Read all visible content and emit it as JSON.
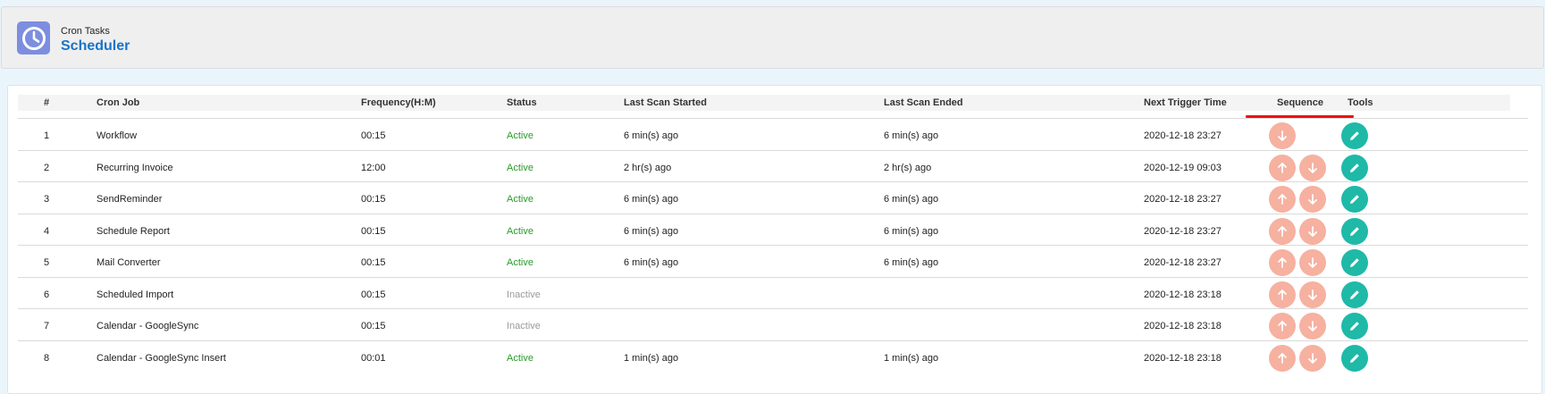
{
  "header": {
    "module": "Cron Tasks",
    "title": "Scheduler"
  },
  "table": {
    "columns": {
      "num": "#",
      "cron_job": "Cron Job",
      "frequency": "Frequency(H:M)",
      "status": "Status",
      "last_scan_started": "Last Scan Started",
      "last_scan_ended": "Last Scan Ended",
      "next_trigger_time": "Next Trigger Time",
      "sequence": "Sequence",
      "tools": "Tools"
    },
    "sorted_column": "Next Trigger Time",
    "rows": [
      {
        "num": "1",
        "cron_job": "Workflow",
        "frequency": "00:15",
        "status": "Active",
        "last_scan_started": "6 min(s) ago",
        "last_scan_ended": "6 min(s) ago",
        "next_trigger_time": "2020-12-18 23:27",
        "sequence": [
          "down"
        ]
      },
      {
        "num": "2",
        "cron_job": "Recurring Invoice",
        "frequency": "12:00",
        "status": "Active",
        "last_scan_started": "2 hr(s) ago",
        "last_scan_ended": "2 hr(s) ago",
        "next_trigger_time": "2020-12-19 09:03",
        "sequence": [
          "up",
          "down"
        ]
      },
      {
        "num": "3",
        "cron_job": "SendReminder",
        "frequency": "00:15",
        "status": "Active",
        "last_scan_started": "6 min(s) ago",
        "last_scan_ended": "6 min(s) ago",
        "next_trigger_time": "2020-12-18 23:27",
        "sequence": [
          "up",
          "down"
        ]
      },
      {
        "num": "4",
        "cron_job": "Schedule Report",
        "frequency": "00:15",
        "status": "Active",
        "last_scan_started": "6 min(s) ago",
        "last_scan_ended": "6 min(s) ago",
        "next_trigger_time": "2020-12-18 23:27",
        "sequence": [
          "up",
          "down"
        ]
      },
      {
        "num": "5",
        "cron_job": "Mail Converter",
        "frequency": "00:15",
        "status": "Active",
        "last_scan_started": "6 min(s) ago",
        "last_scan_ended": "6 min(s) ago",
        "next_trigger_time": "2020-12-18 23:27",
        "sequence": [
          "up",
          "down"
        ]
      },
      {
        "num": "6",
        "cron_job": "Scheduled Import",
        "frequency": "00:15",
        "status": "Inactive",
        "last_scan_started": "",
        "last_scan_ended": "",
        "next_trigger_time": "2020-12-18 23:18",
        "sequence": [
          "up",
          "down"
        ]
      },
      {
        "num": "7",
        "cron_job": "Calendar - GoogleSync",
        "frequency": "00:15",
        "status": "Inactive",
        "last_scan_started": "",
        "last_scan_ended": "",
        "next_trigger_time": "2020-12-18 23:18",
        "sequence": [
          "up",
          "down"
        ]
      },
      {
        "num": "8",
        "cron_job": "Calendar - GoogleSync Insert",
        "frequency": "00:01",
        "status": "Active",
        "last_scan_started": "1 min(s) ago",
        "last_scan_ended": "1 min(s) ago",
        "next_trigger_time": "2020-12-18 23:18",
        "sequence": [
          "up",
          "down"
        ]
      }
    ]
  },
  "icons": {
    "app": "clock-icon",
    "move_up": "arrow-up-icon",
    "move_down": "arrow-down-icon",
    "edit": "pencil-icon"
  },
  "colors": {
    "title": "#1a73c8",
    "app_icon_bg": "#7d8ee0",
    "active": "#2a9a2a",
    "inactive": "#9a9a9a",
    "sequence_button": "#f6b1a0",
    "edit_button": "#1fb9a8",
    "sort_indicator": "#ee1111"
  }
}
